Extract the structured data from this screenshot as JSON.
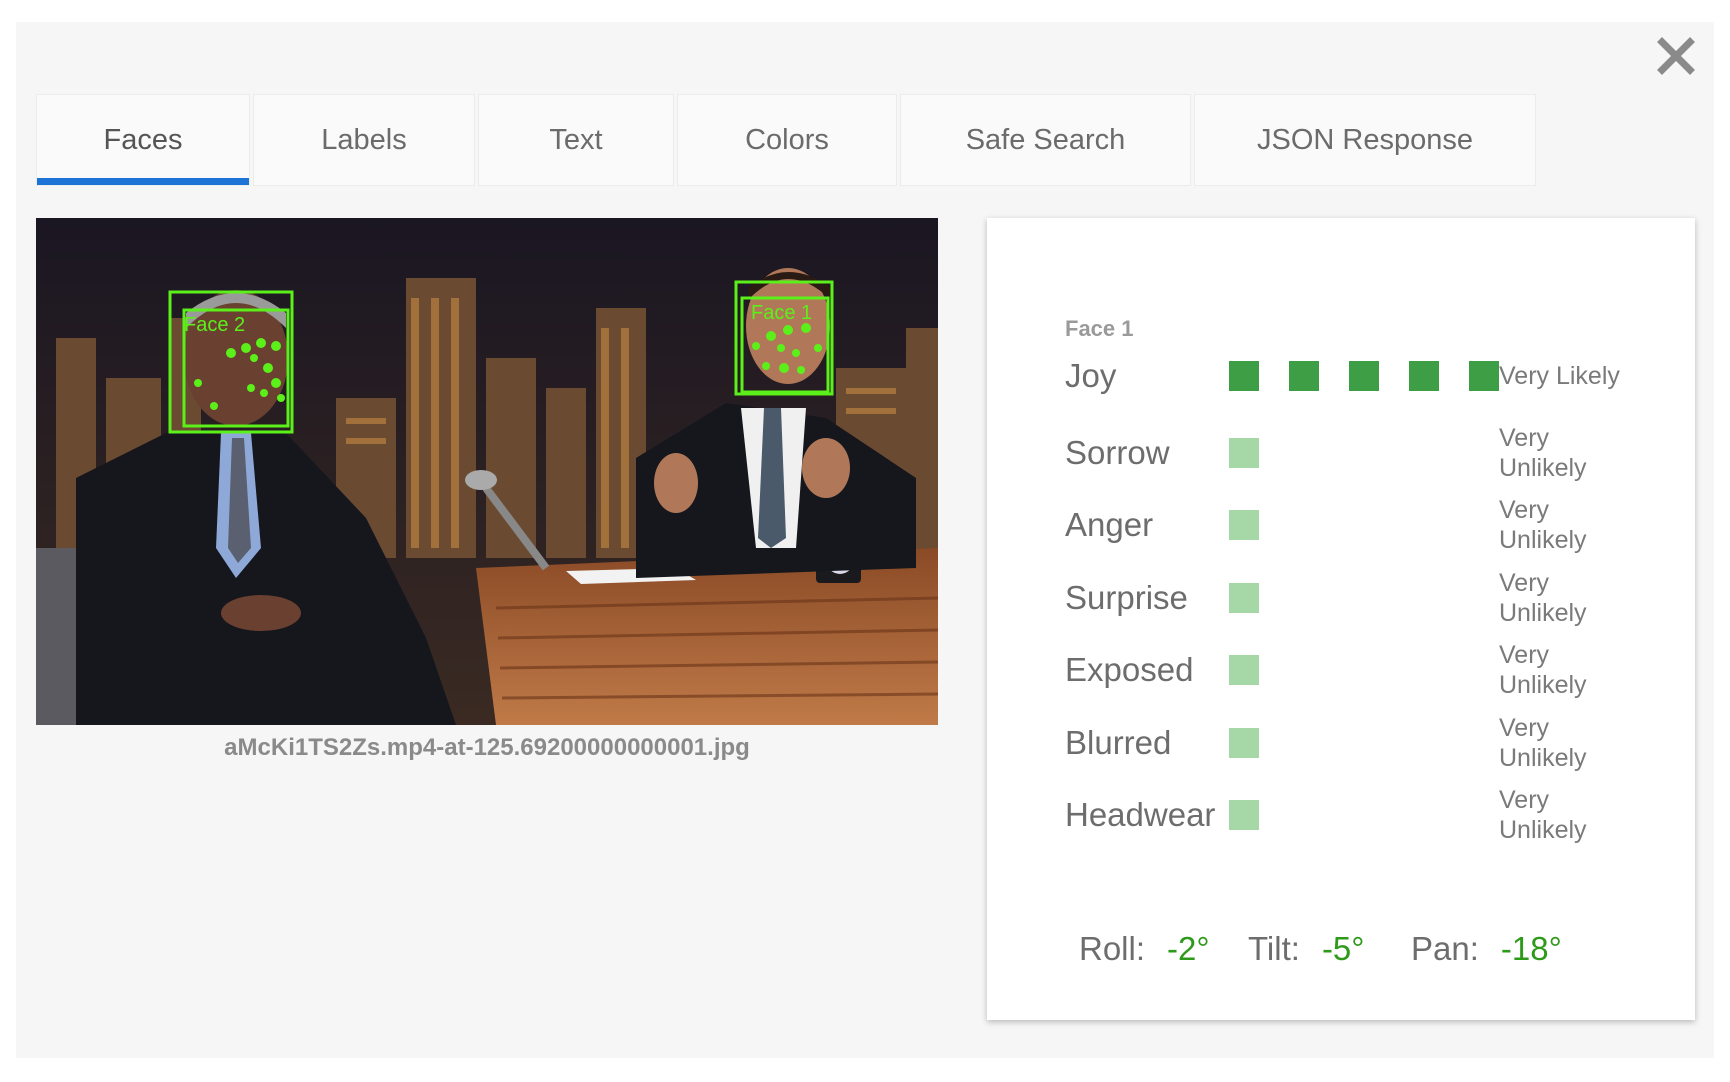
{
  "close_icon": "close-icon",
  "tabs": [
    {
      "label": "Faces",
      "active": true
    },
    {
      "label": "Labels",
      "active": false
    },
    {
      "label": "Text",
      "active": false
    },
    {
      "label": "Colors",
      "active": false
    },
    {
      "label": "Safe Search",
      "active": false
    },
    {
      "label": "JSON Response",
      "active": false
    }
  ],
  "image": {
    "caption": "aMcKi1TS2Zs.mp4-at-125.69200000000001.jpg",
    "face_boxes": [
      {
        "label": "Face 2"
      },
      {
        "label": "Face 1"
      }
    ]
  },
  "panel": {
    "face_title": "Face 1",
    "attributes": [
      {
        "name": "Joy",
        "level": 5,
        "likelihood": "Very Likely"
      },
      {
        "name": "Sorrow",
        "level": 1,
        "likelihood": "Very Unlikely"
      },
      {
        "name": "Anger",
        "level": 1,
        "likelihood": "Very Unlikely"
      },
      {
        "name": "Surprise",
        "level": 1,
        "likelihood": "Very Unlikely"
      },
      {
        "name": "Exposed",
        "level": 1,
        "likelihood": "Very Unlikely"
      },
      {
        "name": "Blurred",
        "level": 1,
        "likelihood": "Very Unlikely"
      },
      {
        "name": "Headwear",
        "level": 1,
        "likelihood": "Very Unlikely"
      }
    ],
    "angles": {
      "roll_label": "Roll:",
      "roll_value": "-2°",
      "tilt_label": "Tilt:",
      "tilt_value": "-5°",
      "pan_label": "Pan:",
      "pan_value": "-18°"
    }
  },
  "colors": {
    "accent": "#1e74d6",
    "bar_strong": "#3d9e45",
    "bar_weak": "#a5d8a6",
    "face_box": "#5cf01a",
    "angle_value": "#2e9a1a"
  }
}
